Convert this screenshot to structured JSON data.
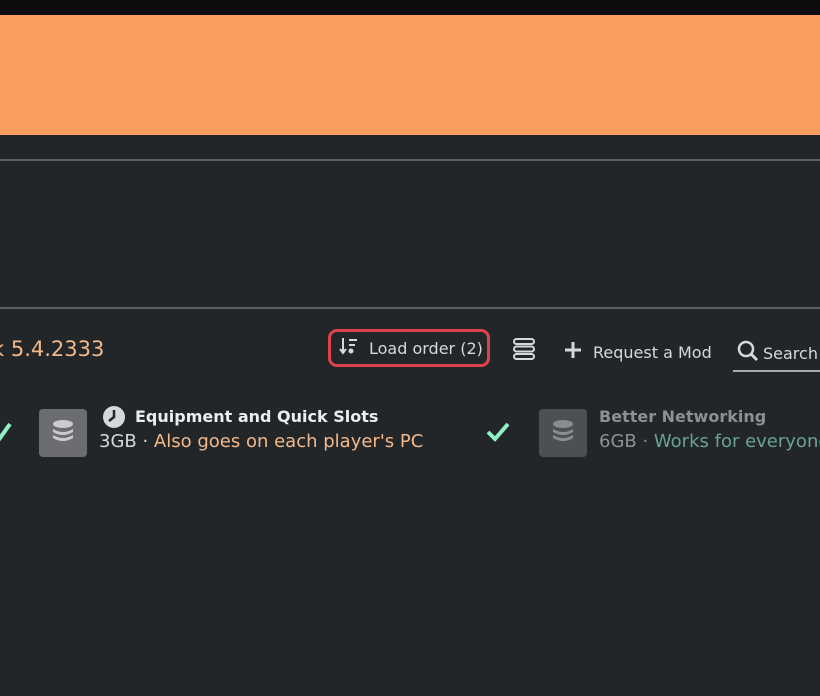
{
  "header": {
    "version_text": "k 5.4.2333"
  },
  "toolbar": {
    "load_order_label": "Load order (2)",
    "request_mod_label": "Request a Mod",
    "search_placeholder": "Search"
  },
  "mods": [
    {
      "title": "Equipment and Quick Slots",
      "size": "3GB",
      "separator": " · ",
      "note": "Also goes on each player's PC",
      "note_color": "#f3b98a",
      "status_icon": "clock-icon"
    },
    {
      "title": "Better Networking",
      "size": "6GB",
      "separator": " · ",
      "note": "Works for everyone",
      "note_color": "#6aa290"
    }
  ],
  "colors": {
    "banner": "#fa9b5f",
    "background": "#232629",
    "highlight_border": "#e0424a",
    "check": "#8ff0c8"
  }
}
